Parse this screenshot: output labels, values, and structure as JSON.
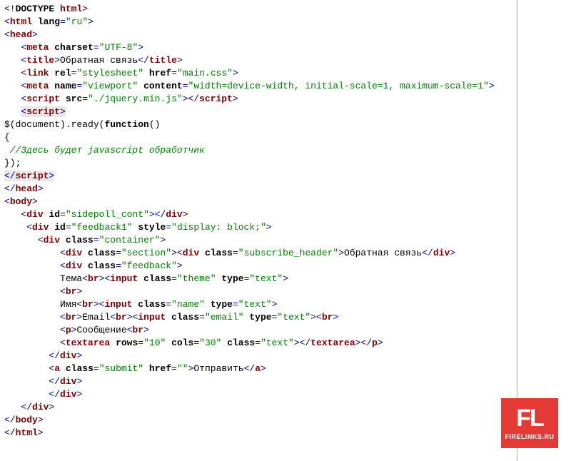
{
  "code": {
    "l1": {
      "p1": "<!",
      "doctype": "DOCTYPE",
      "sp": " ",
      "html": "html",
      "p2": ">"
    },
    "l2": {
      "open": "<",
      "tag": "html",
      "sp": " ",
      "attr": "lang",
      "eq": "=",
      "val": "\"ru\"",
      "close": ">"
    },
    "l3": {
      "open": "<",
      "tag": "head",
      "close": ">"
    },
    "l4": {
      "open": "<",
      "tag": "meta",
      "sp": " ",
      "attr": "charset",
      "eq": "=",
      "val": "\"UTF-8\"",
      "close": ">"
    },
    "l5": {
      "open": "<",
      "tag": "title",
      "close": ">",
      "text": "Обратная связь",
      "open2": "</",
      "tag2": "title",
      "close2": ">"
    },
    "l6": {
      "open": "<",
      "tag": "link",
      "sp1": " ",
      "attr1": "rel",
      "eq1": "=",
      "val1": "\"stylesheet\"",
      "sp2": " ",
      "attr2": "href",
      "eq2": "=",
      "val2": "\"main.css\"",
      "close": ">"
    },
    "l7": {
      "open": "<",
      "tag": "meta",
      "sp1": " ",
      "attr1": "name",
      "eq1": "=",
      "val1": "\"viewport\"",
      "sp2": " ",
      "attr2": "content",
      "eq2": "=",
      "val2": "\"width=device-width, initial-scale=1, maximum-scale=1\"",
      "close": ">"
    },
    "l8": {
      "open": "<",
      "tag": "script",
      "sp": " ",
      "attr": "src",
      "eq": "=",
      "val": "\"./jquery.min.js\"",
      "close": "></",
      "tag2": "script",
      "close2": ">"
    },
    "l9": {
      "open": "<",
      "tag": "script",
      "close": ">"
    },
    "l10": {
      "text": "$(document).ready(",
      "kw": "function",
      "text2": "()"
    },
    "l11": {
      "text": "{"
    },
    "l12": {
      "text": " //Здесь будет javascript обработчик"
    },
    "l13": {
      "text": "});"
    },
    "l14": {
      "open": "</",
      "tag": "script",
      "close": ">"
    },
    "l15": {
      "open": "</",
      "tag": "head",
      "close": ">"
    },
    "l16": {
      "open": "<",
      "tag": "body",
      "close": ">"
    },
    "l17": {
      "open": "<",
      "tag": "div",
      "sp": " ",
      "attr": "id",
      "eq": "=",
      "val": "\"sidepoll_cont\"",
      "close": "></",
      "tag2": "div",
      "close2": ">"
    },
    "l18": {
      "open": "<",
      "tag": "div",
      "sp1": " ",
      "attr1": "id",
      "eq1": "=",
      "val1": "\"feedback1\"",
      "sp2": " ",
      "attr2": "style",
      "eq2": "=",
      "val2": "\"display: block;\"",
      "close": ">"
    },
    "l19": {
      "open": "<",
      "tag": "div",
      "sp": " ",
      "attr": "class",
      "eq": "=",
      "val": "\"container\"",
      "close": ">"
    },
    "l20": {
      "open": "<",
      "tag": "div",
      "sp": " ",
      "attr": "class",
      "eq": "=",
      "val": "\"section\"",
      "close": ">",
      "open2": "<",
      "tag2": "div",
      "sp2": " ",
      "attr2": "class",
      "eq2": "=",
      "val2": "\"subscribe_header\"",
      "close2": ">",
      "text": "Обратная связь",
      "open3": "</",
      "tag3": "div",
      "close3": ">"
    },
    "l21": {
      "open": "<",
      "tag": "div",
      "sp": " ",
      "attr": "class",
      "eq": "=",
      "val": "\"feedback\"",
      "close": ">"
    },
    "l22": {
      "text": "Тема",
      "open": "<",
      "tag": "br",
      "close": "><",
      "tag2": "input",
      "sp": " ",
      "attr": "class",
      "eq": "=",
      "val": "\"theme\"",
      "sp2": " ",
      "attr2": "type",
      "eq2": "=",
      "val2": "\"text\"",
      "close2": ">"
    },
    "l23": {
      "open": "<",
      "tag": "br",
      "close": ">"
    },
    "l24": {
      "text": "Имя",
      "open": "<",
      "tag": "br",
      "close": "><",
      "tag2": "input",
      "sp": " ",
      "attr": "class",
      "eq": "=",
      "val": "\"name\"",
      "sp2": " ",
      "attr2": "type",
      "eq2": "=",
      "val2": "\"text\"",
      "close2": ">"
    },
    "l25": {
      "open": "<",
      "tag": "br",
      "close": ">",
      "text": "Email",
      "open2": "<",
      "tag2": "br",
      "close2": "><",
      "tag3": "input",
      "sp": " ",
      "attr": "class",
      "eq": "=",
      "val": "\"email\"",
      "sp2": " ",
      "attr2": "type",
      "eq2": "=",
      "val2": "\"text\"",
      "close3": "><",
      "tag4": "br",
      "close4": ">"
    },
    "l26": {
      "open": "<",
      "tag": "p",
      "close": ">",
      "text": "Сообщение",
      "open2": "<",
      "tag2": "br",
      "close2": ">"
    },
    "l27": {
      "open": "<",
      "tag": "textarea",
      "sp1": " ",
      "attr1": "rows",
      "eq1": "=",
      "val1": "\"10\"",
      "sp2": " ",
      "attr2": "cols",
      "eq2": "=",
      "val2": "\"30\"",
      "sp3": " ",
      "attr3": "class",
      "eq3": "=",
      "val3": "\"text\"",
      "close": "></",
      "tag2": "textarea",
      "close2": "></",
      "tag3": "p",
      "close3": ">"
    },
    "l28": {
      "open": "</",
      "tag": "div",
      "close": ">"
    },
    "l29": {
      "open": "<",
      "tag": "a",
      "sp1": " ",
      "attr1": "class",
      "eq1": "=",
      "val1": "\"submit\"",
      "sp2": " ",
      "attr2": "href",
      "eq2": "=",
      "val2": "\"\"",
      "close": ">",
      "text": "Отправить",
      "open2": "</",
      "tag2": "a",
      "close2": ">"
    },
    "l30": {
      "open": "</",
      "tag": "div",
      "close": ">"
    },
    "l31": {
      "open": "</",
      "tag": "div",
      "close": ">"
    },
    "l32": {
      "open": "</",
      "tag": "div",
      "close": ">"
    },
    "l33": {
      "open": "</",
      "tag": "body",
      "close": ">"
    },
    "l34": {
      "open": "</",
      "tag": "html",
      "close": ">"
    }
  },
  "logo": {
    "main": "FL",
    "sub": "FIRELINKS.RU"
  }
}
